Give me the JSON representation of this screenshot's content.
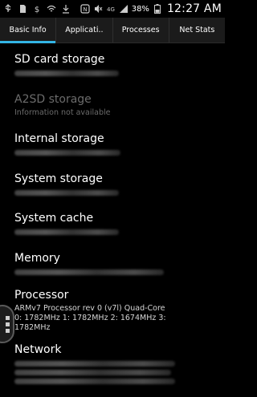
{
  "status_bar": {
    "left_icons": [
      "usb-icon",
      "sd-card-icon",
      "dollar-icon",
      "wifi-lock-icon",
      "download-icon"
    ],
    "right_icons": [
      "nfc-icon",
      "mute-icon",
      "signal-4g-icon",
      "signal-bars-icon"
    ],
    "battery_percent": "38%",
    "time": "12:27 AM"
  },
  "tabs": [
    {
      "label": "Basic Info",
      "active": true
    },
    {
      "label": "Applicati..",
      "active": false
    },
    {
      "label": "Processes",
      "active": false
    },
    {
      "label": "Net Stats",
      "active": false
    }
  ],
  "items": [
    {
      "title": "SD card storage",
      "sub": "",
      "blurred": true,
      "dim": false
    },
    {
      "title": "A2SD storage",
      "sub": "Information not available",
      "blurred": false,
      "dim": true
    },
    {
      "title": "Internal storage",
      "sub": "",
      "blurred": true,
      "dim": false
    },
    {
      "title": "System storage",
      "sub": "",
      "blurred": true,
      "dim": false
    },
    {
      "title": "System cache",
      "sub": "",
      "blurred": true,
      "dim": false
    },
    {
      "title": "Memory",
      "sub": "",
      "blurred": true,
      "dim": false
    },
    {
      "title": "Processor",
      "sub": "ARMv7 Processor rev 0 (v7l) Quad-Core\n0: 1782MHz  1: 1782MHz  2: 1674MHz  3:\n1782MHz",
      "blurred": false,
      "dim": false
    },
    {
      "title": "Network",
      "sub": "",
      "blurred": true,
      "dim": false
    }
  ],
  "floating_handle": {
    "icon": "drag-handle-icon"
  },
  "colors": {
    "accent": "#33b5e5",
    "background": "#000000",
    "tabbar": "#1b1b1b",
    "dim_text": "#6b6b6b"
  }
}
